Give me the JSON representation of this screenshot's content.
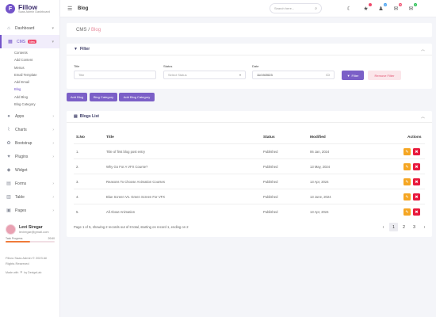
{
  "brand": {
    "logo_letter": "F",
    "name": "Fillow",
    "subtitle": "Saas Admin Dashboard"
  },
  "sidebar": {
    "items": [
      {
        "label": "Dashboard",
        "icon": "home-icon"
      },
      {
        "label": "CMS",
        "icon": "cms-icon",
        "badge": "New"
      },
      {
        "label": "Apps",
        "icon": "apps-icon"
      },
      {
        "label": "Charts",
        "icon": "chart-icon"
      },
      {
        "label": "Bootstrap",
        "icon": "bootstrap-icon"
      },
      {
        "label": "Plugins",
        "icon": "heart-icon"
      },
      {
        "label": "Widget",
        "icon": "widget-icon"
      },
      {
        "label": "Forms",
        "icon": "forms-icon"
      },
      {
        "label": "Table",
        "icon": "table-icon"
      },
      {
        "label": "Pages",
        "icon": "pages-icon"
      }
    ],
    "cms_sub": [
      "Contents",
      "Add Content",
      "Menus",
      "Email Template",
      "Add Email",
      "Blog",
      "Add Blog",
      "Blog Category"
    ],
    "user": {
      "name": "Levi Siregar",
      "email": "leviregar@gmail.com",
      "progress_label": "Task Progress",
      "progress_value": "20/40",
      "progress_fraction": 0.5
    },
    "copyright": "Fillow Saas Admin © 2023 All Rights Reserved",
    "made_with": "Made with",
    "made_by": "by DexignLab"
  },
  "topbar": {
    "title": "Blog",
    "search_placeholder": "Search here...",
    "counts": {
      "bell": "12",
      "chat": "76",
      "email": "8"
    }
  },
  "breadcrumb": {
    "root": "CMS",
    "separator": "/",
    "current": "Blog"
  },
  "filter": {
    "heading": "Filter",
    "title_label": "Title",
    "title_placeholder": "Title",
    "status_label": "Status",
    "status_value": "Select Status",
    "date_label": "Date",
    "date_value": "11/19/2023",
    "filter_button": "Filter",
    "remove_button": "Remove Filter"
  },
  "actions": {
    "add_blog": "Add Blog",
    "blog_category": "Blog Category",
    "add_blog_category": "Add Blog Category"
  },
  "blogs": {
    "heading": "Blogs List",
    "columns": {
      "sno": "S.No",
      "title": "Title",
      "status": "Status",
      "modified": "Modified",
      "actions": "Actions"
    },
    "rows": [
      {
        "sno": "1.",
        "title": "Title of first blog post entry",
        "status": "Published",
        "modified": "06 Jan, 2024"
      },
      {
        "sno": "2.",
        "title": "Why Go For A VFX Course?",
        "status": "Published",
        "modified": "13 May, 2024"
      },
      {
        "sno": "3.",
        "title": "Reasons To Choose Animation Courses",
        "status": "Published",
        "modified": "13 Apr, 2024"
      },
      {
        "sno": "4.",
        "title": "Blue Screen Vs. Green Screen For VFX",
        "status": "Published",
        "modified": "13 June, 2024"
      },
      {
        "sno": "5.",
        "title": "All About Animation",
        "status": "Published",
        "modified": "13 Apr, 2024"
      }
    ],
    "pagination_text": "Page 1 of 5, showing 2 records out of 8 total, starting on record 1, ending on 2",
    "pages": [
      "‹",
      "1",
      "2",
      "3",
      "›"
    ]
  },
  "colors": {
    "accent": "#7353c9",
    "edit": "#f5a623",
    "delete": "#e8193c",
    "breadcrumb_current": "#e7899b"
  }
}
